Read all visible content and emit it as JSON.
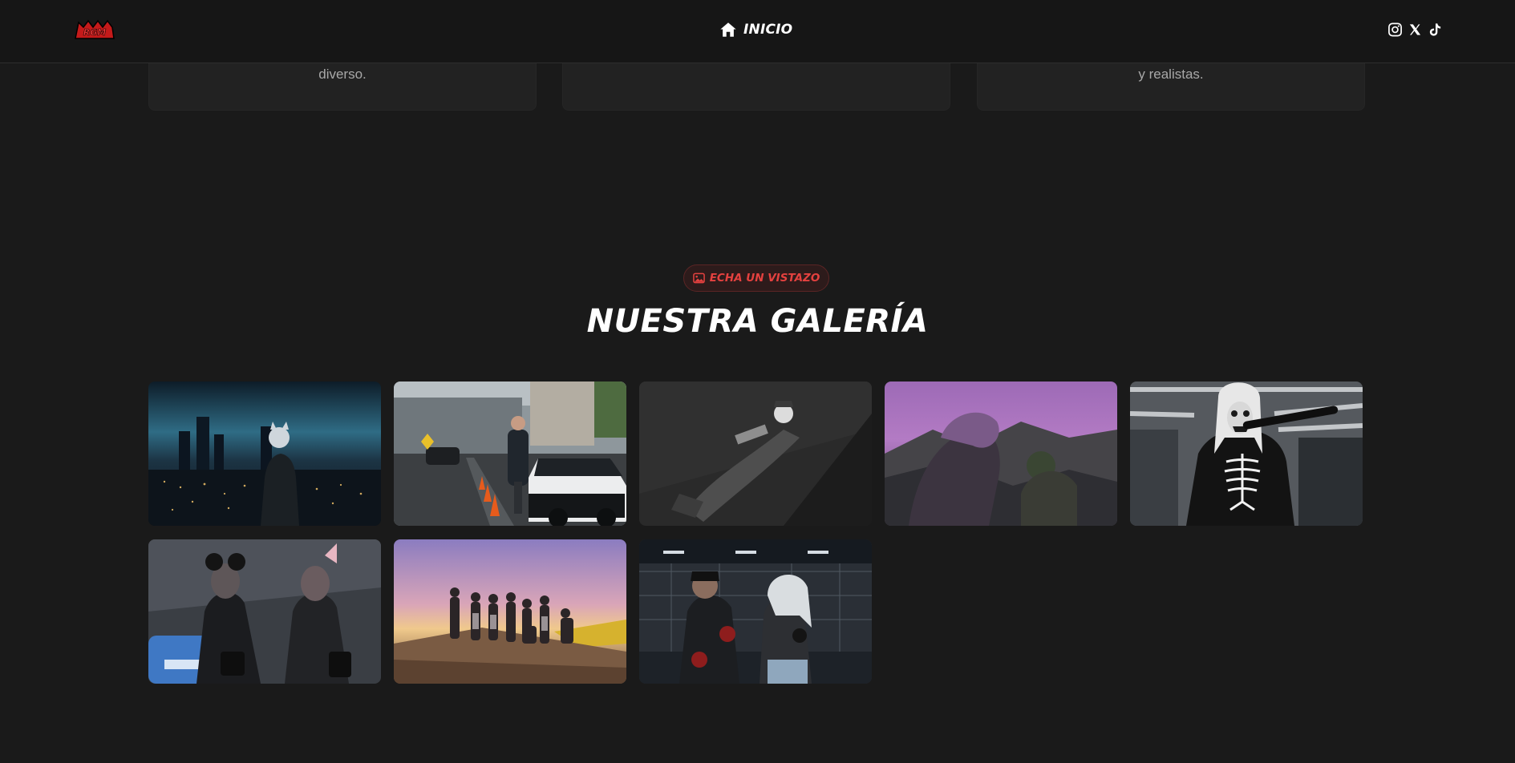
{
  "header": {
    "logo_text": "RGM",
    "nav_home_label": "INICIO",
    "socials": [
      "instagram-icon",
      "x-icon",
      "tiktok-icon"
    ]
  },
  "feature_cards": [
    {
      "text": "diverso."
    },
    {
      "text": ""
    },
    {
      "text": "y realistas."
    }
  ],
  "gallery": {
    "badge_label": "ECHA UN VISTAZO",
    "title": "NUESTRA GALERÍA",
    "images": [
      {
        "name": "city-night-view"
      },
      {
        "name": "police-traffic-stop"
      },
      {
        "name": "masked-figure-grayscale"
      },
      {
        "name": "purple-sky-hills"
      },
      {
        "name": "skeleton-hoodie-character"
      },
      {
        "name": "two-masked-women"
      },
      {
        "name": "group-sunset-photo"
      },
      {
        "name": "boxing-gym-fight"
      }
    ]
  },
  "colors": {
    "background": "#1a1a1a",
    "accent": "#e4413f",
    "header": "#161616"
  }
}
